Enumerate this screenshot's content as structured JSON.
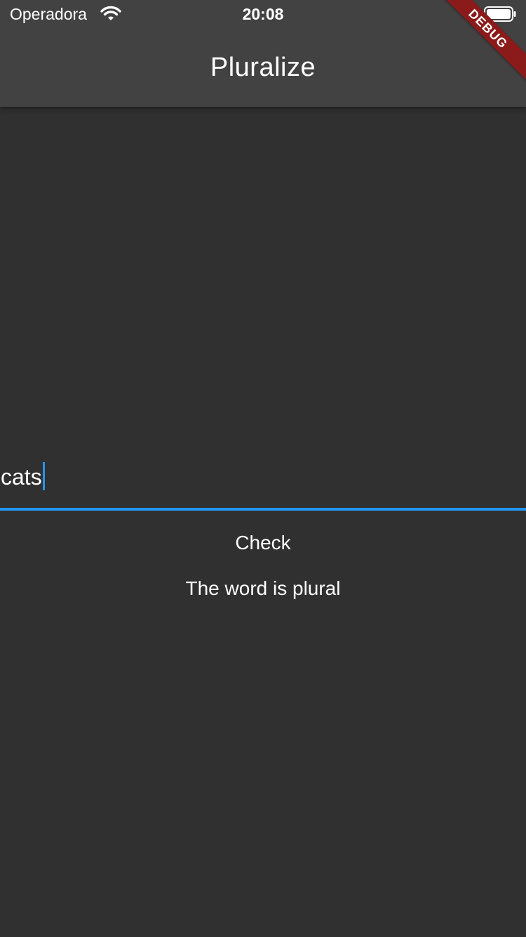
{
  "status_bar": {
    "carrier": "Operadora",
    "time": "20:08",
    "wifi_icon": "wifi-icon",
    "battery_icon": "battery-icon"
  },
  "app_bar": {
    "title": "Pluralize",
    "background": "#424242"
  },
  "debug_banner": "DEBUG",
  "input": {
    "value": "cats",
    "accent": "#2196f3"
  },
  "actions": {
    "check_label": "Check"
  },
  "result": {
    "message": "The word is plural"
  },
  "colors": {
    "background": "#303030",
    "accent": "#2196f3",
    "debug": "#8b1a1a"
  }
}
